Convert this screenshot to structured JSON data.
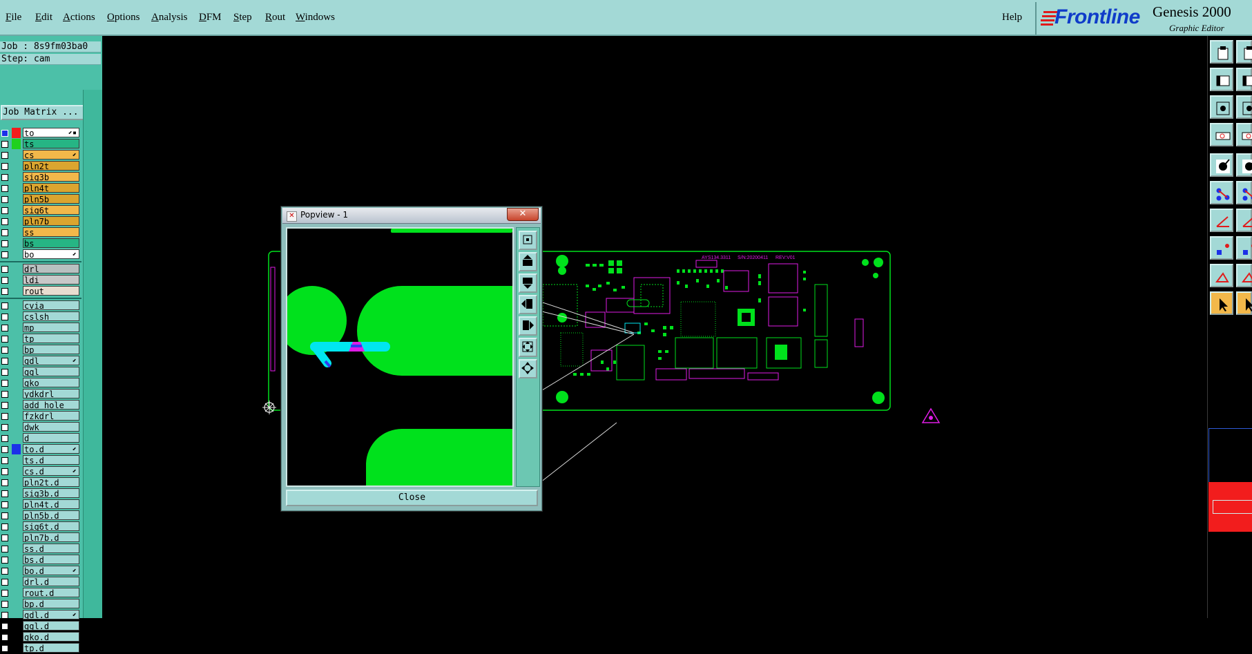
{
  "menu": {
    "items": [
      "File",
      "Edit",
      "Actions",
      "Options",
      "Analysis",
      "DFM",
      "Step",
      "Rout",
      "Windows"
    ],
    "help": "Help"
  },
  "branding": {
    "logo": "Frontline",
    "product": "Genesis 2000",
    "subtitle": "Graphic Editor",
    "logo_color": "#0f3cc9"
  },
  "job": {
    "job_line": "Job : 8s9fm03ba0",
    "step_line": "Step: cam",
    "matrix_button": "Job Matrix ..."
  },
  "layers": {
    "group1": [
      {
        "name": "to",
        "check": "blue",
        "swatch": "#f21d1d",
        "color": "#ffffff",
        "arrow": true,
        "extra": true
      },
      {
        "name": "ts",
        "check": "white",
        "swatch": "#1fd11f",
        "color": "#26b584"
      },
      {
        "name": "cs",
        "check": "white",
        "swatch": "",
        "color": "#f2b84a",
        "arrow": true
      },
      {
        "name": "pln2t",
        "check": "white",
        "swatch": "",
        "color": "#dba52f"
      },
      {
        "name": "sig3b",
        "check": "white",
        "swatch": "",
        "color": "#f2b84a"
      },
      {
        "name": "pln4t",
        "check": "white",
        "swatch": "",
        "color": "#dba52f"
      },
      {
        "name": "pln5b",
        "check": "white",
        "swatch": "",
        "color": "#dba52f"
      },
      {
        "name": "sig6t",
        "check": "white",
        "swatch": "",
        "color": "#f2b84a"
      },
      {
        "name": "pln7b",
        "check": "white",
        "swatch": "",
        "color": "#dba52f"
      },
      {
        "name": "ss",
        "check": "white",
        "swatch": "",
        "color": "#f2b84a"
      },
      {
        "name": "bs",
        "check": "white",
        "swatch": "",
        "color": "#26b584"
      },
      {
        "name": "bo",
        "check": "white",
        "swatch": "",
        "color": "#ffffff",
        "arrow": true
      }
    ],
    "group2": [
      {
        "name": "drl",
        "check": "white",
        "swatch": "",
        "color": "#b8c0c0"
      },
      {
        "name": "ldi",
        "check": "white",
        "swatch": "",
        "color": "#c8c8c8"
      },
      {
        "name": "rout",
        "check": "white",
        "swatch": "",
        "color": "#e8ddd0"
      }
    ],
    "group3": [
      {
        "name": "cvia"
      },
      {
        "name": "cslsh"
      },
      {
        "name": "mp"
      },
      {
        "name": "tp"
      },
      {
        "name": "bp"
      },
      {
        "name": "gdl",
        "arrow": true
      },
      {
        "name": "ggl"
      },
      {
        "name": "gko"
      },
      {
        "name": "ydkdrl"
      },
      {
        "name": "add_hole"
      },
      {
        "name": "fzkdrl"
      },
      {
        "name": "dwk"
      },
      {
        "name": "d"
      },
      {
        "name": "to.d",
        "swatch": "#1c30e8",
        "arrow": true
      },
      {
        "name": "ts.d"
      },
      {
        "name": "cs.d",
        "arrow": true
      },
      {
        "name": "pln2t.d"
      },
      {
        "name": "sig3b.d"
      },
      {
        "name": "pln4t.d"
      },
      {
        "name": "pln5b.d"
      },
      {
        "name": "sig6t.d"
      },
      {
        "name": "pln7b.d"
      },
      {
        "name": "ss.d"
      },
      {
        "name": "bs.d"
      },
      {
        "name": "bo.d",
        "arrow": true
      },
      {
        "name": "drl.d"
      },
      {
        "name": "rout.d"
      },
      {
        "name": "bp.d"
      },
      {
        "name": "gdl.d",
        "arrow": true
      },
      {
        "name": "ggl.d"
      },
      {
        "name": "gko.d"
      },
      {
        "name": "tp.d"
      }
    ],
    "group3_color": "#a3d9d6"
  },
  "popview": {
    "title": "Popview - 1",
    "close_button": "Close",
    "tools": [
      "zoom-home-icon",
      "step-up-icon",
      "step-down-icon",
      "step-left-icon",
      "step-right-icon",
      "zoom-fit-icon",
      "pan-icon"
    ]
  },
  "pcb_text": {
    "part_no": "AYS134.3311",
    "date": "S/N:20200411",
    "rev": "REV:V01"
  },
  "colors": {
    "accent_green": "#00e11c",
    "magenta": "#e01ce6",
    "cyan": "#00e6ef",
    "panel": "#a3d9d6"
  }
}
